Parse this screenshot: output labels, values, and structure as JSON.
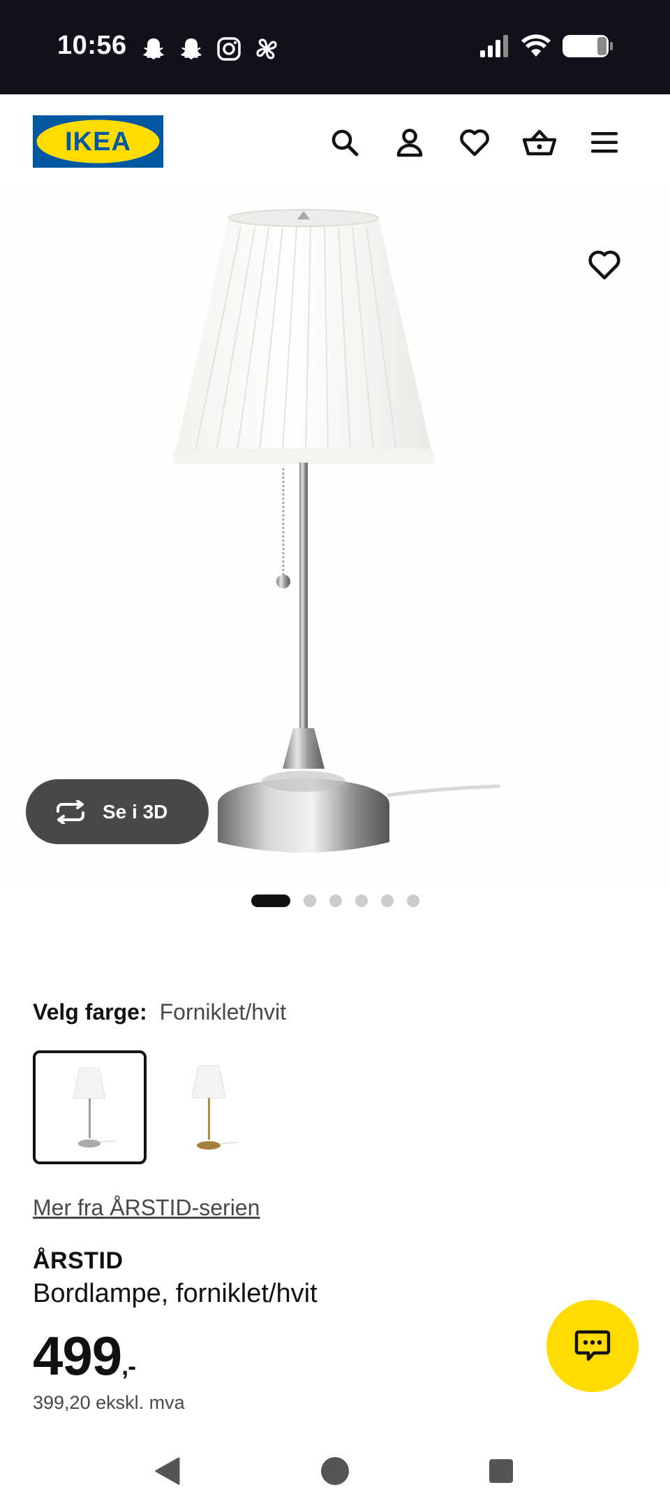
{
  "status_bar": {
    "time": "10:56",
    "left_icons": [
      "snapchat-icon",
      "snapchat-icon",
      "instagram-icon",
      "pinwheel-icon"
    ],
    "right_icons": [
      "signal-icon",
      "wifi-icon",
      "battery-icon"
    ]
  },
  "header": {
    "logo_text": "IKEA",
    "icons": [
      "search-icon",
      "account-icon",
      "heart-icon",
      "basket-icon",
      "menu-icon"
    ]
  },
  "gallery": {
    "view_3d_label": "Se i 3D",
    "image_count": 6,
    "active_index": 0
  },
  "color": {
    "label": "Velg farge:",
    "value": "Forniklet/hvit",
    "options": [
      "Forniklet/hvit",
      "Messing/hvit"
    ],
    "selected_index": 0
  },
  "product": {
    "series_link": "Mer fra ÅRSTID-serien",
    "name": "ÅRSTID",
    "description": "Bordlampe, forniklet/hvit",
    "price": "499",
    "price_suffix": ",-",
    "price_ex_vat": "399,20 ekskl. mva"
  },
  "colors": {
    "status_bar_bg": "#10111a",
    "ikea_blue": "#0058a3",
    "ikea_yellow": "#ffdb00",
    "button_dark": "#484848"
  }
}
